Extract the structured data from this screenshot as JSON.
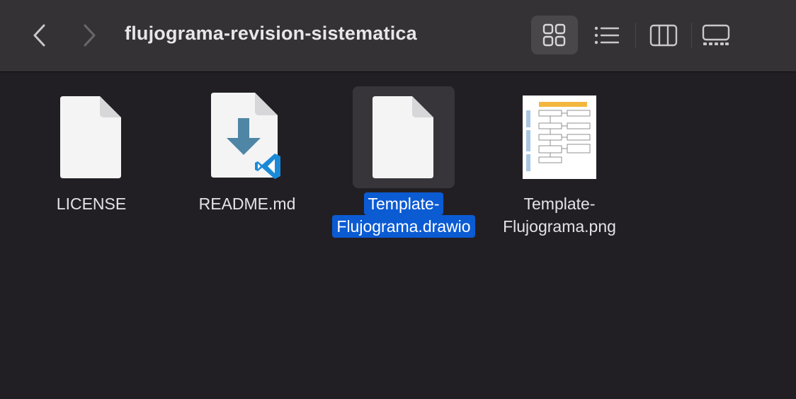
{
  "window": {
    "title": "flujograma-revision-sistematica"
  },
  "toolbar": {
    "back_icon": "chevron-left-icon",
    "forward_icon": "chevron-right-icon",
    "views": [
      {
        "name": "icons",
        "icon": "grid-icon",
        "active": true
      },
      {
        "name": "list",
        "icon": "list-icon",
        "active": false
      },
      {
        "name": "columns",
        "icon": "columns-icon",
        "active": false
      },
      {
        "name": "gallery",
        "icon": "gallery-icon",
        "active": false
      }
    ]
  },
  "files": [
    {
      "name_line1": "LICENSE",
      "name_line2": "",
      "icon": "generic-document-icon",
      "selected": false
    },
    {
      "name_line1": "README.md",
      "name_line2": "",
      "icon": "vscode-markdown-icon",
      "selected": false
    },
    {
      "name_line1": "Template-",
      "name_line2": "Flujograma.drawio",
      "icon": "generic-document-icon",
      "selected": true
    },
    {
      "name_line1": "Template-",
      "name_line2": "Flujograma.png",
      "icon": "image-thumbnail-icon",
      "selected": false
    }
  ],
  "colors": {
    "background": "#221f24",
    "toolbar": "#353236",
    "selection": "#0b5bd3",
    "vscode_blue": "#1a8ad8",
    "download_arrow": "#4f86a6"
  }
}
